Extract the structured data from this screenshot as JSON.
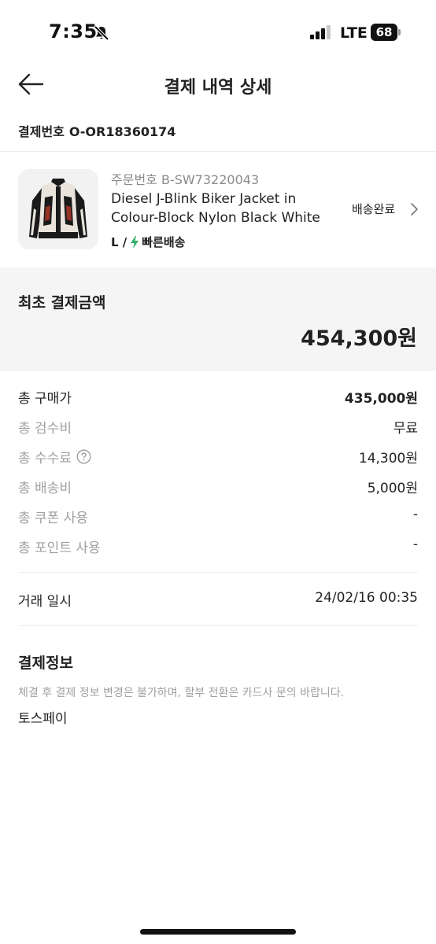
{
  "status_bar": {
    "time": "7:35",
    "network": "LTE",
    "battery": "68"
  },
  "nav": {
    "title": "결제 내역 상세"
  },
  "payment_number": {
    "label": "결제번호",
    "value": "O-OR18360174"
  },
  "product": {
    "order_number": "주문번호 B-SW73220043",
    "name_line1": "Diesel J-Blink Biker Jacket in",
    "name_line2": "Colour-Block Nylon Black White",
    "size": "L /",
    "delivery_type": "빠른배송",
    "status": "배송완료"
  },
  "total": {
    "label": "최초 결제금액",
    "amount": "454,300원"
  },
  "breakdown": [
    {
      "label": "총 구매가",
      "value": "435,000원"
    },
    {
      "label": "총 검수비",
      "value": "무료"
    },
    {
      "label": "총 수수료",
      "value": "14,300원"
    },
    {
      "label": "총 배송비",
      "value": "5,000원"
    },
    {
      "label": "총 쿠폰 사용",
      "value": "-"
    },
    {
      "label": "총 포인트 사용",
      "value": "-"
    }
  ],
  "trade": {
    "label": "거래 일시",
    "value": "24/02/16 00:35"
  },
  "payment_info": {
    "title": "결제정보",
    "note": "체결 후 결제 정보 변경은 불가하며, 할부 전환은 카드사 문의 바랍니다.",
    "method": "토스페이"
  },
  "colors": {
    "accent_green": "#31b46e",
    "muted_text": "#a0a0a0",
    "summary_bg": "#f5f5f5"
  }
}
